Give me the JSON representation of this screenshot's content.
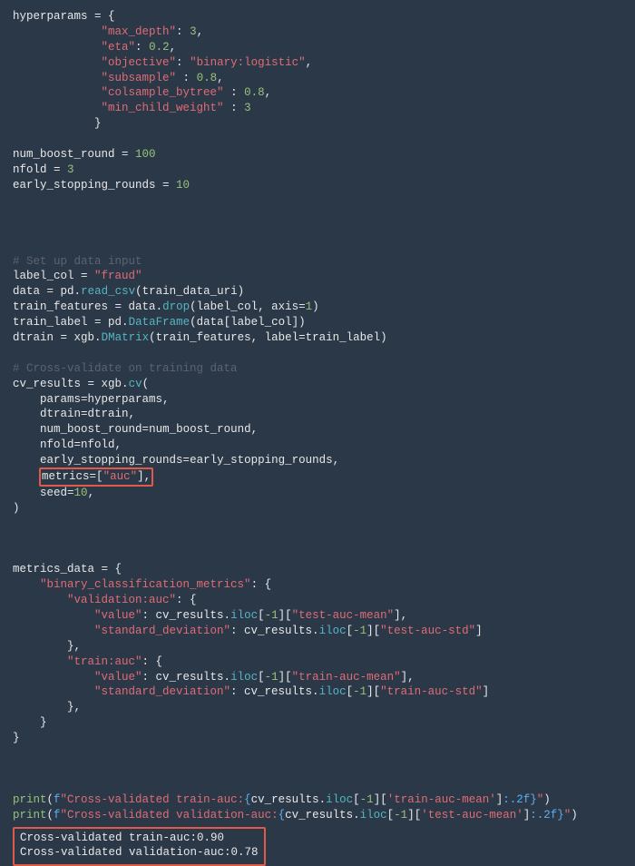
{
  "hp": {
    "varname": "hyperparams",
    "max_depth_k": "\"max_depth\"",
    "max_depth_v": "3",
    "eta_k": "\"eta\"",
    "eta_v": "0.2",
    "objective_k": "\"objective\"",
    "objective_v": "\"binary:logistic\"",
    "subsample_k": "\"subsample\"",
    "subsample_v": "0.8",
    "colsample_k": "\"colsample_bytree\"",
    "colsample_v": "0.8",
    "mincw_k": "\"min_child_weight\"",
    "mincw_v": "3"
  },
  "nbr": {
    "name": "num_boost_round",
    "val": "100"
  },
  "nfold": {
    "name": "nfold",
    "val": "3"
  },
  "esr": {
    "name": "early_stopping_rounds",
    "val": "10"
  },
  "comment1": "# Set up data input",
  "label_col": {
    "name": "label_col",
    "val": "\"fraud\""
  },
  "data_line": {
    "name": "data",
    "pd": "pd",
    "dot": ".",
    "fn": "read_csv",
    "arg": "(train_data_uri)"
  },
  "tf_line": {
    "name": "train_features",
    "rhs1": "data",
    "drop": "drop",
    "args_pre": "(label_col, axis",
    "eq": "=",
    "one": "1",
    "close": ")"
  },
  "tl_line": {
    "name": "train_label",
    "pd": "pd",
    "dot": ".",
    "fn": "DataFrame",
    "args": "(data[label_col])"
  },
  "dt_line": {
    "name": "dtrain",
    "xgb": "xgb",
    "dot": ".",
    "fn": "DMatrix",
    "args_pre": "(train_features, label",
    "eq": "=",
    "rhs": "train_label)"
  },
  "comment2": "# Cross-validate on training data",
  "cv": {
    "lhs": "cv_results",
    "xgb": "xgb",
    "dot": ".",
    "fn": "cv",
    "open": "(",
    "params_k": "params",
    "params_v": "hyperparams,",
    "dtrain_k": "dtrain",
    "dtrain_v": "dtrain,",
    "nbr_k": "num_boost_round",
    "nbr_v": "num_boost_round,",
    "nfold_k": "nfold",
    "nfold_v": "nfold,",
    "esr_k": "early_stopping_rounds",
    "esr_v": "early_stopping_rounds,",
    "metrics_k": "metrics",
    "metrics_v_open": "[",
    "metrics_v_str": "\"auc\"",
    "metrics_v_close": "]",
    "comma": ",",
    "seed_k": "seed",
    "seed_v": "10",
    "seed_comma": ",",
    "close": ")"
  },
  "md": {
    "lhs": "metrics_data",
    "bcm": "\"binary_classification_metrics\"",
    "vauc": "\"validation:auc\"",
    "tauc": "\"train:auc\"",
    "value": "\"value\"",
    "stddev": "\"standard_deviation\"",
    "iloc": "iloc",
    "neg1": "-1",
    "test_mean": "\"test-auc-mean\"",
    "test_std": "\"test-auc-std\"",
    "train_mean": "\"train-auc-mean\"",
    "train_std": "\"train-auc-std\""
  },
  "print": {
    "fn": "print",
    "f": "f",
    "str1a": "\"Cross-validated train-auc:",
    "str2a": "\"Cross-validated validation-auc:",
    "open_br": "{",
    "cvres": "cv_results",
    "iloc": "iloc",
    "neg1": "-1",
    "train_key": "'train-auc-mean'",
    "test_key": "'test-auc-mean'",
    "fmt": ":.2f",
    "close_br": "}",
    "strclose": "\"",
    "paren_close": ")"
  },
  "output": {
    "line1": "Cross-validated train-auc:0.90",
    "line2": "Cross-validated validation-auc:0.78"
  }
}
